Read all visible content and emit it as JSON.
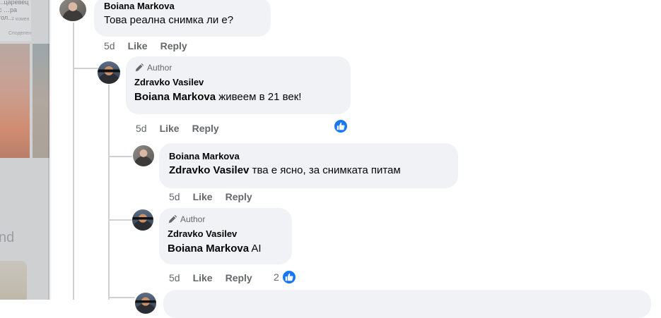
{
  "background": {
    "snippet_text": "...царевец с\n…ра гол…",
    "snippet_meta1": "7 комен",
    "snippet_meta2": "Споделен",
    "partial_word": "nd"
  },
  "comments": [
    {
      "author": "Boiana Markova",
      "is_author_badge": false,
      "mention": "",
      "text": "Това реална снимка ли е?",
      "time": "5d",
      "like_label": "Like",
      "reply_label": "Reply",
      "reaction_count": ""
    },
    {
      "author": "Zdravko Vasilev",
      "is_author_badge": true,
      "badge_label": "Author",
      "mention": "Boiana Markova",
      "text": " живеем в 21 век!",
      "time": "5d",
      "like_label": "Like",
      "reply_label": "Reply",
      "reaction_count": ""
    },
    {
      "author": "Boiana Markova",
      "is_author_badge": false,
      "mention": "Zdravko Vasilev",
      "text": " тва е ясно, за снимката питам",
      "time": "5d",
      "like_label": "Like",
      "reply_label": "Reply",
      "reaction_count": ""
    },
    {
      "author": "Zdravko Vasilev",
      "is_author_badge": true,
      "badge_label": "Author",
      "mention": "Boiana Markova",
      "text": " AI",
      "time": "5d",
      "like_label": "Like",
      "reply_label": "Reply",
      "reaction_count": "2"
    }
  ],
  "colors": {
    "bubble": "#f0f2f5",
    "like_blue": "#1877f2",
    "meta_gray": "#65676b"
  },
  "icons": {
    "author": "pencil-author-icon",
    "like": "thumbs-up-icon"
  }
}
